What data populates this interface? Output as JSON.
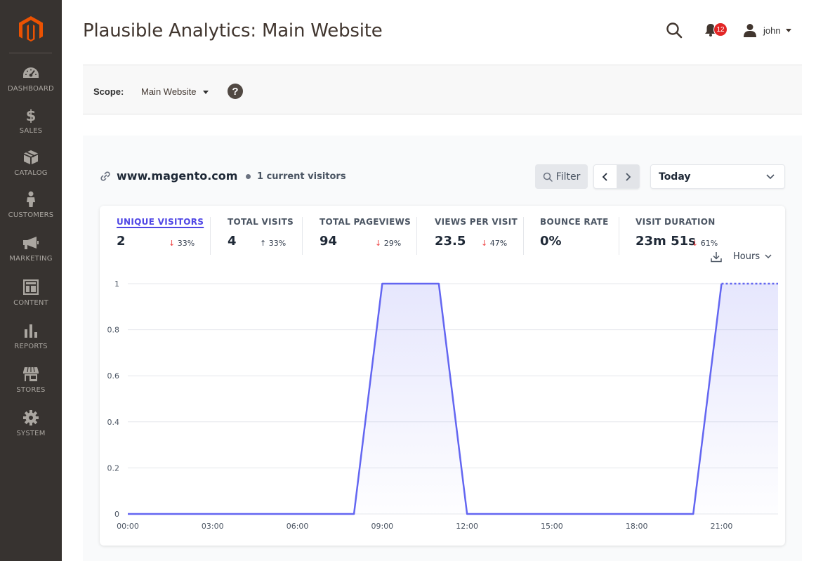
{
  "page": {
    "title": "Plausible Analytics: Main Website"
  },
  "sidebar": {
    "items": [
      {
        "label": "DASHBOARD",
        "icon": "dashboard-icon"
      },
      {
        "label": "SALES",
        "icon": "dollar-icon"
      },
      {
        "label": "CATALOG",
        "icon": "box-icon"
      },
      {
        "label": "CUSTOMERS",
        "icon": "person-icon"
      },
      {
        "label": "MARKETING",
        "icon": "megaphone-icon"
      },
      {
        "label": "CONTENT",
        "icon": "layout-icon"
      },
      {
        "label": "REPORTS",
        "icon": "bar-chart-icon"
      },
      {
        "label": "STORES",
        "icon": "store-icon"
      },
      {
        "label": "SYSTEM",
        "icon": "gear-icon"
      }
    ]
  },
  "header": {
    "notifications_count": "12",
    "user_name": "john"
  },
  "scope": {
    "label": "Scope:",
    "value": "Main Website"
  },
  "site": {
    "domain": "www.magento.com",
    "current_visitors": "1 current visitors"
  },
  "controls": {
    "filter_label": "Filter",
    "date_range": "Today",
    "interval": "Hours"
  },
  "metrics": [
    {
      "label": "UNIQUE VISITORS",
      "value": "2",
      "change": "33%",
      "direction": "down",
      "active": true
    },
    {
      "label": "TOTAL VISITS",
      "value": "4",
      "change": "33%",
      "direction": "up",
      "active": false
    },
    {
      "label": "TOTAL PAGEVIEWS",
      "value": "94",
      "change": "29%",
      "direction": "down",
      "active": false
    },
    {
      "label": "VIEWS PER VISIT",
      "value": "23.5",
      "change": "47%",
      "direction": "down",
      "active": false
    },
    {
      "label": "BOUNCE RATE",
      "value": "0%",
      "change": "",
      "direction": "",
      "active": false
    },
    {
      "label": "VISIT DURATION",
      "value": "23m 51s",
      "change": "61%",
      "direction": "down",
      "active": false
    }
  ],
  "colors": {
    "sidebar": "#373330",
    "brand": "#eb5202",
    "accent": "#6366f1",
    "down": "#ef4444"
  },
  "chart_data": {
    "type": "area",
    "x": [
      "00:00",
      "01:00",
      "02:00",
      "03:00",
      "04:00",
      "05:00",
      "06:00",
      "07:00",
      "08:00",
      "09:00",
      "10:00",
      "11:00",
      "12:00",
      "13:00",
      "14:00",
      "15:00",
      "16:00",
      "17:00",
      "18:00",
      "19:00",
      "20:00",
      "21:00",
      "22:00"
    ],
    "tick_labels": [
      "00:00",
      "03:00",
      "06:00",
      "09:00",
      "12:00",
      "15:00",
      "18:00",
      "21:00"
    ],
    "series": [
      {
        "values": [
          0,
          0,
          0,
          0,
          0,
          0,
          0,
          0,
          0,
          1,
          1,
          1,
          0,
          0,
          0,
          0,
          0,
          0,
          0,
          0,
          0,
          1,
          1
        ]
      }
    ],
    "y_ticks": [
      "0",
      "0.2",
      "0.4",
      "0.6",
      "0.8",
      "1"
    ],
    "ylim": [
      0,
      1
    ],
    "grid": true,
    "dashed_last_segment": true
  }
}
